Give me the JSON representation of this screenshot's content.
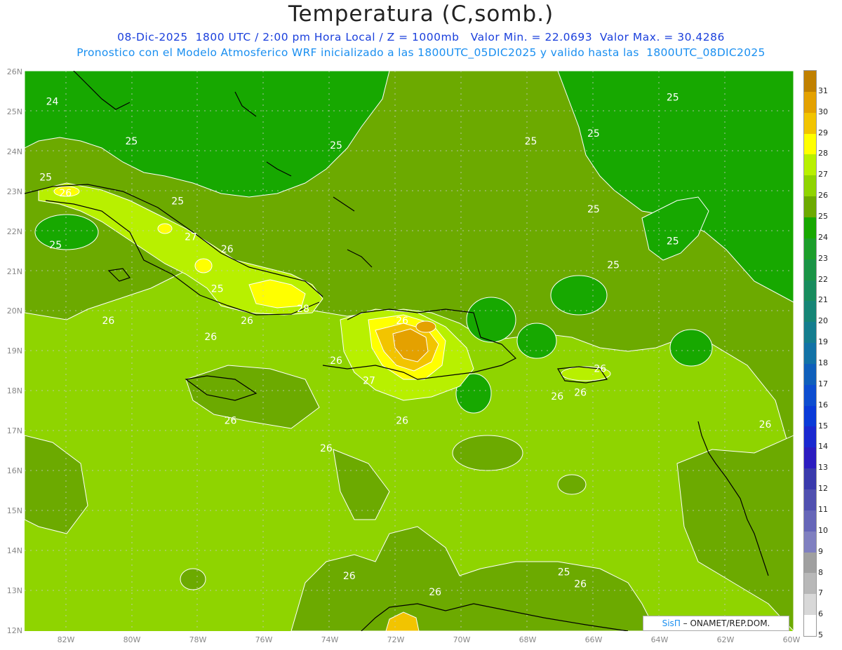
{
  "title": "Temperatura (C,somb.)",
  "subtitle_line1": "08-Dic-2025  1800 UTC / 2:00 pm Hora Local / Z = 1000mb   Valor Min. = 22.0693  Valor Max. = 30.4286",
  "subtitle_line2": "Pronostico con el Modelo Atmosferico WRF inicializado a las 1800UTC_05DIC2025 y valido hasta las  1800UTC_08DIC2025",
  "credit": {
    "brand": "SisΠ",
    "text": " – ONAMET/REP.DOM."
  },
  "lat_ticks": [
    "26N",
    "25N",
    "24N",
    "23N",
    "22N",
    "21N",
    "20N",
    "19N",
    "18N",
    "17N",
    "16N",
    "15N",
    "14N",
    "13N",
    "12N"
  ],
  "lon_ticks": [
    "82W",
    "80W",
    "78W",
    "76W",
    "74W",
    "72W",
    "70W",
    "68W",
    "66W",
    "64W",
    "62W",
    "60W"
  ],
  "colorbar": {
    "labels": [
      "31",
      "30",
      "29",
      "28",
      "27",
      "26",
      "25",
      "24",
      "23",
      "22",
      "21",
      "20",
      "19",
      "18",
      "17",
      "16",
      "15",
      "14",
      "13",
      "12",
      "11",
      "10",
      "9",
      "8",
      "7",
      "6",
      "5"
    ],
    "colors": [
      "#c08000",
      "#e4a100",
      "#f2c400",
      "#ffff00",
      "#b8f000",
      "#8fd400",
      "#6caa00",
      "#17a800",
      "#1c9e2a",
      "#1a9446",
      "#188c5e",
      "#168576",
      "#147d8e",
      "#1272a6",
      "#0f5fbb",
      "#0d4dd0",
      "#0a3ad8",
      "#1a28d0",
      "#2c1cc0",
      "#3a3aac",
      "#5050b0",
      "#6666b8",
      "#8080c0",
      "#a0a0a0",
      "#b8b8b8",
      "#d8d8d8",
      "#ffffff"
    ]
  },
  "contour_labels": [
    {
      "text": "24",
      "lon": -82.6,
      "lat": 25.2
    },
    {
      "text": "25",
      "lon": -80.2,
      "lat": 24.2
    },
    {
      "text": "25",
      "lon": -82.8,
      "lat": 23.3
    },
    {
      "text": "26",
      "lon": -82.2,
      "lat": 22.9
    },
    {
      "text": "25",
      "lon": -78.8,
      "lat": 22.7
    },
    {
      "text": "27",
      "lon": -78.4,
      "lat": 21.8
    },
    {
      "text": "25",
      "lon": -82.5,
      "lat": 21.6
    },
    {
      "text": "26",
      "lon": -77.3,
      "lat": 21.5
    },
    {
      "text": "25",
      "lon": -77.6,
      "lat": 20.5
    },
    {
      "text": "26",
      "lon": -76.7,
      "lat": 19.7
    },
    {
      "text": "26",
      "lon": -80.9,
      "lat": 19.7
    },
    {
      "text": "26",
      "lon": -77.8,
      "lat": 19.3
    },
    {
      "text": "28",
      "lon": -75.0,
      "lat": 20.0
    },
    {
      "text": "25",
      "lon": -74.0,
      "lat": 24.1
    },
    {
      "text": "25",
      "lon": -68.1,
      "lat": 24.2
    },
    {
      "text": "25",
      "lon": -66.2,
      "lat": 24.4
    },
    {
      "text": "25",
      "lon": -63.8,
      "lat": 25.3
    },
    {
      "text": "25",
      "lon": -66.2,
      "lat": 22.5
    },
    {
      "text": "25",
      "lon": -63.8,
      "lat": 21.7
    },
    {
      "text": "25",
      "lon": -65.6,
      "lat": 21.1
    },
    {
      "text": "26",
      "lon": -72.0,
      "lat": 19.7
    },
    {
      "text": "26",
      "lon": -74.0,
      "lat": 18.7
    },
    {
      "text": "27",
      "lon": -73.0,
      "lat": 18.2
    },
    {
      "text": "26",
      "lon": -67.3,
      "lat": 17.8
    },
    {
      "text": "26",
      "lon": -66.6,
      "lat": 17.9
    },
    {
      "text": "26",
      "lon": -66.0,
      "lat": 18.5
    },
    {
      "text": "26",
      "lon": -77.2,
      "lat": 17.2
    },
    {
      "text": "26",
      "lon": -72.0,
      "lat": 17.2
    },
    {
      "text": "26",
      "lon": -74.3,
      "lat": 16.5
    },
    {
      "text": "26",
      "lon": -61.0,
      "lat": 17.1
    },
    {
      "text": "26",
      "lon": -73.6,
      "lat": 13.3
    },
    {
      "text": "26",
      "lon": -71.0,
      "lat": 12.9
    },
    {
      "text": "25",
      "lon": -67.1,
      "lat": 13.4
    },
    {
      "text": "26",
      "lon": -66.6,
      "lat": 13.1
    }
  ]
}
